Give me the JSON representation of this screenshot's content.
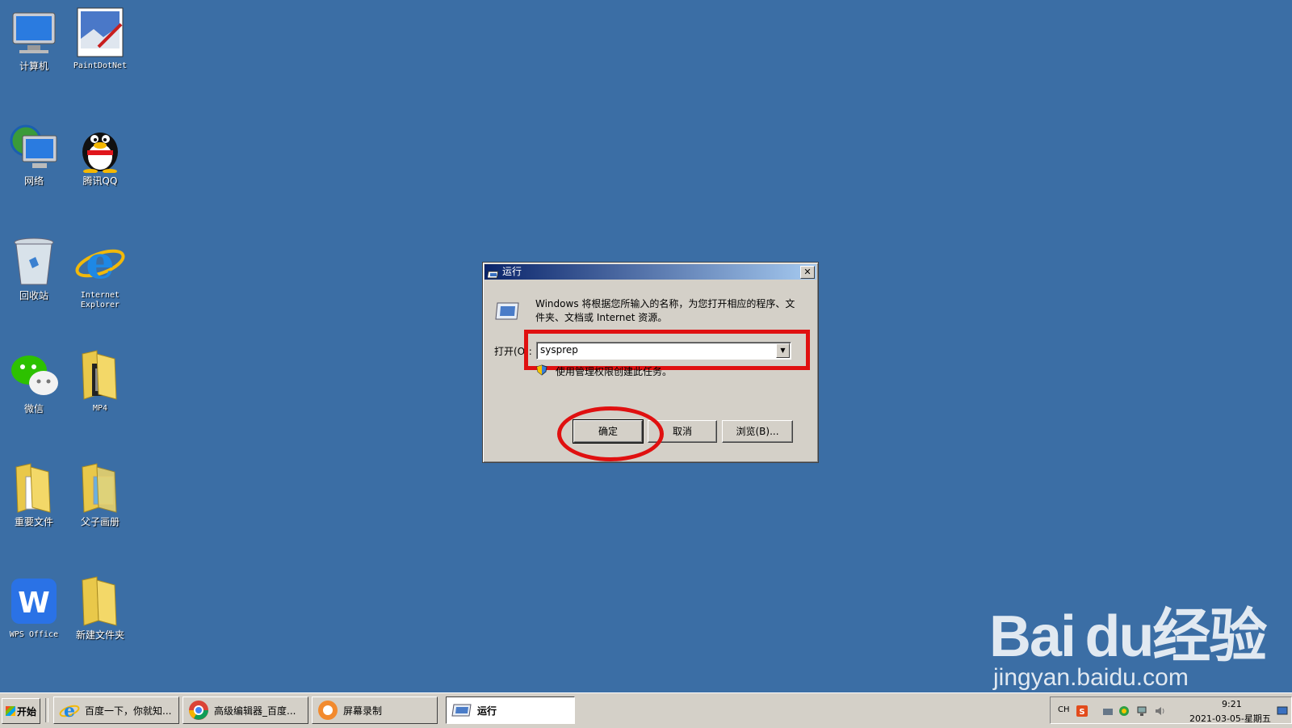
{
  "desktop": {
    "icons": [
      {
        "label": "计算机",
        "icon": "computer-icon"
      },
      {
        "label": "PaintDotNet",
        "icon": "paint-icon"
      },
      {
        "label": "网络",
        "icon": "network-icon"
      },
      {
        "label": "腾讯QQ",
        "icon": "qq-icon"
      },
      {
        "label": "回收站",
        "icon": "recycle-bin-icon"
      },
      {
        "label": "Internet Explorer",
        "icon": "ie-icon"
      },
      {
        "label": "微信",
        "icon": "wechat-icon"
      },
      {
        "label": "MP4",
        "icon": "folder-icon"
      },
      {
        "label": "重要文件",
        "icon": "folder-icon"
      },
      {
        "label": "父子画册",
        "icon": "folder-icon"
      },
      {
        "label": "WPS Office",
        "icon": "wps-icon"
      },
      {
        "label": "新建文件夹",
        "icon": "folder-icon"
      }
    ]
  },
  "dialog": {
    "title": "运行",
    "description": "Windows 将根据您所输入的名称，为您打开相应的程序、文件夹、文档或 Internet 资源。",
    "open_label": "打开(O):",
    "input_value": "sysprep",
    "admin_note": "使用管理权限创建此任务。",
    "ok_label": "确定",
    "cancel_label": "取消",
    "browse_label": "浏览(B)...",
    "close_label": "✕"
  },
  "taskbar": {
    "start_label": "开始",
    "tasks": [
      {
        "label": "百度一下，你就知...",
        "icon": "ie-icon"
      },
      {
        "label": "高级编辑器_百度...",
        "icon": "chrome-icon"
      },
      {
        "label": "屏幕录制",
        "icon": "recorder-icon"
      },
      {
        "label": "运行",
        "icon": "run-icon"
      }
    ],
    "tray": {
      "lang": "CH",
      "time": "9:21",
      "date": "2021-03-05-星期五"
    }
  },
  "watermark": {
    "brand": "Bai du经验",
    "url": "jingyan.baidu.com"
  },
  "colors": {
    "desktop": "#3b6ea5",
    "highlight": "#e01010",
    "titlebar_start": "#0a246a"
  }
}
